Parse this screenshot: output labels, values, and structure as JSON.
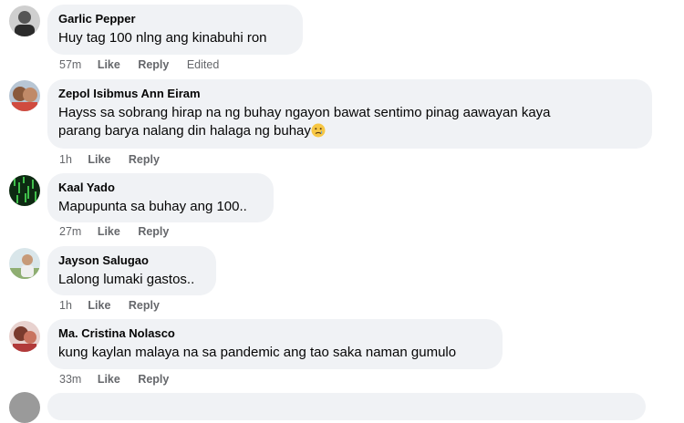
{
  "comments": [
    {
      "author": "Garlic Pepper",
      "text": "Huy tag 100 nlng ang kinabuhi ron",
      "time": "57m",
      "like": "Like",
      "reply": "Reply",
      "edited": "Edited"
    },
    {
      "author": "Zepol Isibmus Ann Eiram",
      "text_line1": "Hayss sa sobrang hirap na ng buhay ngayon bawat sentimo pinag aawayan kaya",
      "text_line2": "parang barya nalang din halaga ng buhay",
      "emoji": "crying-face",
      "time": "1h",
      "like": "Like",
      "reply": "Reply"
    },
    {
      "author": "Kaal Yado",
      "text": "Mapupunta sa buhay ang 100..",
      "time": "27m",
      "like": "Like",
      "reply": "Reply"
    },
    {
      "author": "Jayson Salugao",
      "text": "Lalong lumaki gastos..",
      "time": "1h",
      "like": "Like",
      "reply": "Reply"
    },
    {
      "author": "Ma. Cristina Nolasco",
      "text": "kung kaylan malaya na sa pandemic ang tao saka naman gumulo",
      "time": "33m",
      "like": "Like",
      "reply": "Reply"
    }
  ],
  "colors": {
    "bubble": "#f0f2f5",
    "meta": "#65676b",
    "text": "#050505"
  }
}
